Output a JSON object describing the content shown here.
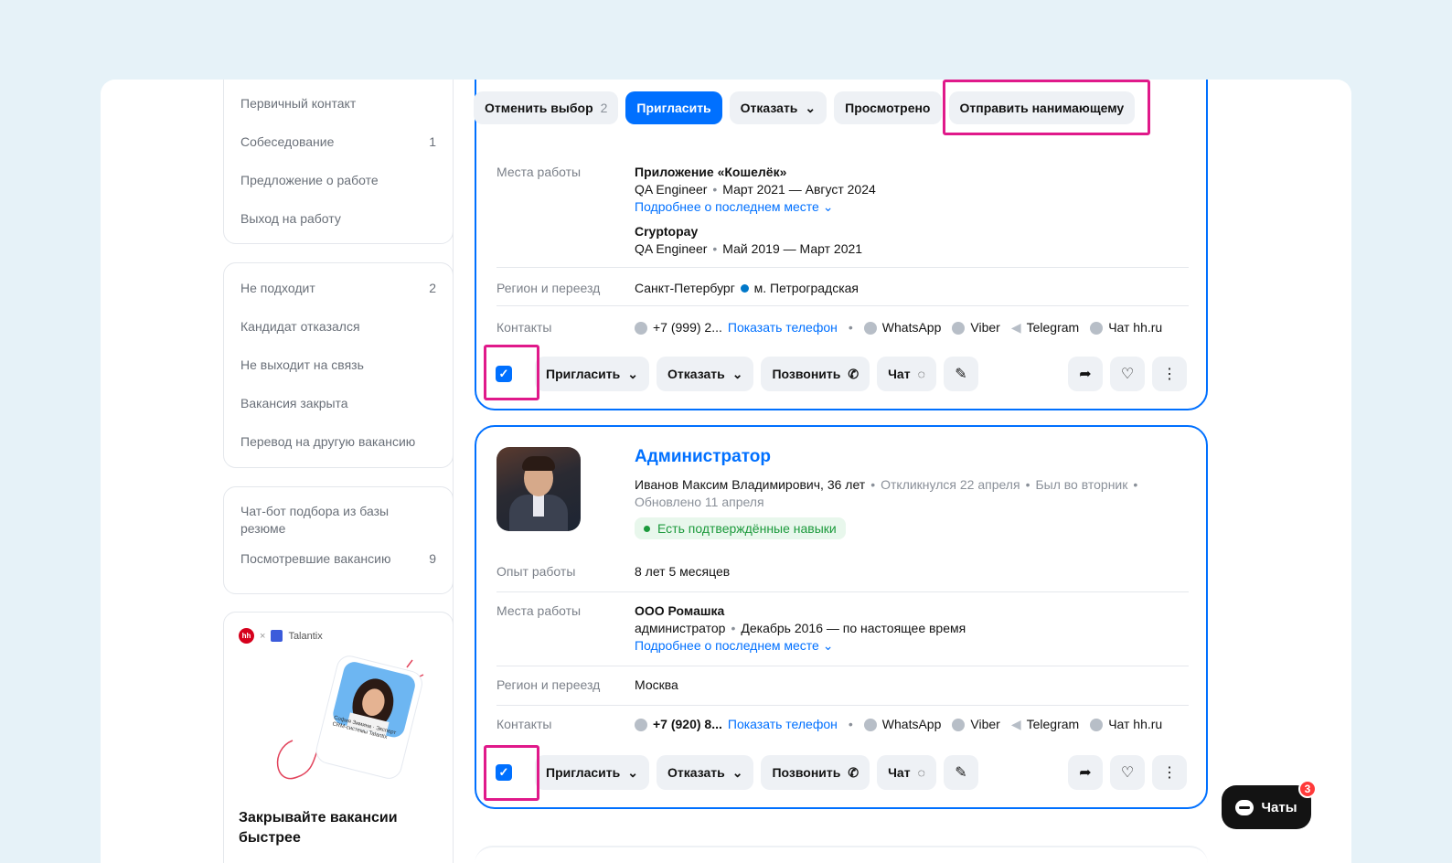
{
  "sidebar": {
    "group1": [
      {
        "label": "Первичный контакт",
        "count": ""
      },
      {
        "label": "Собеседование",
        "count": "1"
      },
      {
        "label": "Предложение о работе",
        "count": ""
      },
      {
        "label": "Выход на работу",
        "count": ""
      }
    ],
    "group2": [
      {
        "label": "Не подходит",
        "count": "2"
      },
      {
        "label": "Кандидат отказался",
        "count": ""
      },
      {
        "label": "Не выходит на связь",
        "count": ""
      },
      {
        "label": "Вакансия закрыта",
        "count": ""
      },
      {
        "label": "Перевод на другую вакансию",
        "count": ""
      }
    ],
    "group3": [
      {
        "label": "Чат-бот подбора из базы резюме",
        "count": ""
      },
      {
        "label": "Посмотревшие вакансию",
        "count": "9"
      }
    ],
    "promo": {
      "logo_hh": "hh",
      "cross": "×",
      "logo_talantix": "Talantix",
      "person_card": "София Зимина · Эксперт CRM-системы Talantix",
      "title": "Закрывайте вакансии быстрее"
    }
  },
  "toolbar": {
    "cancel_label": "Отменить выбор",
    "cancel_count": "2",
    "invite_label": "Пригласить",
    "reject_label": "Отказать",
    "viewed_label": "Просмотрено",
    "send_label": "Отправить нанимающему"
  },
  "card1": {
    "workplaces_label": "Места работы",
    "job1_company": "Приложение «Кошелёк»",
    "job1_role": "QA Engineer",
    "job1_period": "Март 2021 — Август 2024",
    "more_last": "Подробнее о последнем месте",
    "job2_company": "Cryptopay",
    "job2_role": "QA Engineer",
    "job2_period": "Май 2019 — Март 2021",
    "region_label": "Регион и переезд",
    "region_city": "Санкт-Петербург",
    "region_metro": "м. Петроградская",
    "contacts_label": "Контакты",
    "phone": "+7 (999) 2...",
    "show_phone": "Показать телефон",
    "whatsapp": "WhatsApp",
    "viber": "Viber",
    "telegram": "Telegram",
    "hhchat": "Чат hh.ru"
  },
  "card2": {
    "title": "Администратор",
    "name": "Иванов Максим Владимирович, 36 лет",
    "responded": "Откликнулся 22 апреля",
    "was": "Был во вторник",
    "updated": "Обновлено 11 апреля",
    "skills_badge": "Есть подтверждённые навыки",
    "experience_label": "Опыт работы",
    "experience": "8 лет 5 месяцев",
    "workplaces_label": "Места работы",
    "job1_company": "ООО Ромашка",
    "job1_role": "администратор",
    "job1_period": "Декабрь 2016 — по настоящее время",
    "more_last": "Подробнее о последнем месте",
    "region_label": "Регион и переезд",
    "region_city": "Москва",
    "contacts_label": "Контакты",
    "phone": "+7 (920) 8...",
    "show_phone": "Показать телефон",
    "whatsapp": "WhatsApp",
    "viber": "Viber",
    "telegram": "Telegram",
    "hhchat": "Чат hh.ru"
  },
  "actions": {
    "invite": "Пригласить",
    "reject": "Отказать",
    "call": "Позвонить",
    "chat": "Чат"
  },
  "chats_widget": {
    "label": "Чаты",
    "count": "3"
  },
  "colors": {
    "accent": "#0070ff",
    "highlight": "#e0198a",
    "badge_green": "#1c9a3c"
  }
}
